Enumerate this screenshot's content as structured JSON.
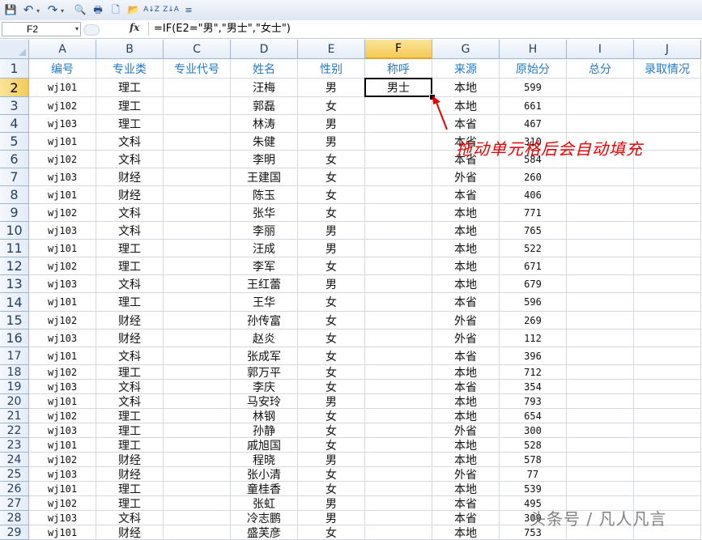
{
  "toolbar": {
    "icons": [
      "save-icon",
      "undo-icon",
      "redo-icon",
      "print-preview-icon",
      "print-icon",
      "new-icon",
      "open-icon",
      "sort-ascending-icon",
      "sort-descending-icon",
      "customize-icon"
    ],
    "undo_glyph": "↶",
    "redo_glyph": "↷",
    "dropdown_glyph": "▾",
    "save_glyph": "💾",
    "print_preview_glyph": "🔍",
    "print_glyph": "🖶",
    "new_glyph": "🗋",
    "open_glyph": "📂",
    "sort_asc_glyph": "A↓Z",
    "sort_desc_glyph": "Z↓A",
    "customize_glyph": "≡"
  },
  "formula_bar": {
    "name_box": "F2",
    "fx_label": "fx",
    "formula": "=IF(E2=\"男\",\"男士\",\"女士\")"
  },
  "sheet": {
    "columns": [
      "A",
      "B",
      "C",
      "D",
      "E",
      "F",
      "G",
      "H",
      "I",
      "J"
    ],
    "selected_column": "F",
    "selected_row": "2",
    "header_row": [
      "编号",
      "专业类",
      "专业代号",
      "姓名",
      "性别",
      "称呼",
      "来源",
      "原始分",
      "总分",
      "录取情况"
    ],
    "rows": [
      [
        "wj101",
        "理工",
        "",
        "汪梅",
        "男",
        "男士",
        "本地",
        "599",
        "",
        ""
      ],
      [
        "wj102",
        "理工",
        "",
        "郭磊",
        "女",
        "",
        "本地",
        "661",
        "",
        ""
      ],
      [
        "wj103",
        "理工",
        "",
        "林涛",
        "男",
        "",
        "本省",
        "467",
        "",
        ""
      ],
      [
        "wj101",
        "文科",
        "",
        "朱健",
        "男",
        "",
        "本省",
        "310",
        "",
        ""
      ],
      [
        "wj102",
        "文科",
        "",
        "李明",
        "女",
        "",
        "本省",
        "584",
        "",
        ""
      ],
      [
        "wj103",
        "财经",
        "",
        "王建国",
        "女",
        "",
        "外省",
        "260",
        "",
        ""
      ],
      [
        "wj101",
        "财经",
        "",
        "陈玉",
        "女",
        "",
        "本省",
        "406",
        "",
        ""
      ],
      [
        "wj102",
        "文科",
        "",
        "张华",
        "女",
        "",
        "本地",
        "771",
        "",
        ""
      ],
      [
        "wj103",
        "文科",
        "",
        "李丽",
        "男",
        "",
        "本地",
        "765",
        "",
        ""
      ],
      [
        "wj101",
        "理工",
        "",
        "汪成",
        "男",
        "",
        "本地",
        "522",
        "",
        ""
      ],
      [
        "wj102",
        "理工",
        "",
        "李军",
        "女",
        "",
        "本地",
        "671",
        "",
        ""
      ],
      [
        "wj103",
        "文科",
        "",
        "王红蕾",
        "男",
        "",
        "本地",
        "679",
        "",
        ""
      ],
      [
        "wj101",
        "理工",
        "",
        "王华",
        "女",
        "",
        "本省",
        "596",
        "",
        ""
      ],
      [
        "wj102",
        "财经",
        "",
        "孙传富",
        "女",
        "",
        "外省",
        "269",
        "",
        ""
      ],
      [
        "wj103",
        "财经",
        "",
        "赵炎",
        "女",
        "",
        "外省",
        "112",
        "",
        ""
      ],
      [
        "wj101",
        "文科",
        "",
        "张成军",
        "女",
        "",
        "本省",
        "396",
        "",
        ""
      ],
      [
        "wj102",
        "理工",
        "",
        "郭万平",
        "女",
        "",
        "本地",
        "712",
        "",
        ""
      ],
      [
        "wj103",
        "文科",
        "",
        "李庆",
        "女",
        "",
        "本省",
        "354",
        "",
        ""
      ],
      [
        "wj101",
        "文科",
        "",
        "马安玲",
        "男",
        "",
        "本地",
        "793",
        "",
        ""
      ],
      [
        "wj102",
        "理工",
        "",
        "林钢",
        "女",
        "",
        "本地",
        "654",
        "",
        ""
      ],
      [
        "wj103",
        "理工",
        "",
        "孙静",
        "女",
        "",
        "外省",
        "300",
        "",
        ""
      ],
      [
        "wj101",
        "理工",
        "",
        "戚旭国",
        "女",
        "",
        "本地",
        "528",
        "",
        ""
      ],
      [
        "wj102",
        "财经",
        "",
        "程晓",
        "男",
        "",
        "本地",
        "578",
        "",
        ""
      ],
      [
        "wj103",
        "财经",
        "",
        "张小清",
        "女",
        "",
        "外省",
        "77",
        "",
        ""
      ],
      [
        "wj101",
        "理工",
        "",
        "童桂香",
        "女",
        "",
        "本地",
        "539",
        "",
        ""
      ],
      [
        "wj102",
        "理工",
        "",
        "张虹",
        "男",
        "",
        "本省",
        "495",
        "",
        ""
      ],
      [
        "wj103",
        "文科",
        "",
        "冷志鹏",
        "男",
        "",
        "本省",
        "309",
        "",
        ""
      ],
      [
        "wj101",
        "财经",
        "",
        "盛芙彦",
        "女",
        "",
        "本地",
        "753",
        "",
        ""
      ]
    ]
  },
  "annotation": {
    "text": "拖动单元格后会自动填充",
    "color": "#e60000"
  },
  "watermark": {
    "text": "头条号 / 凡人凡言"
  },
  "colors": {
    "header_text": "#1f7ac8",
    "selected_header": "#f5c955",
    "grid_line": "#d4d9e0"
  }
}
